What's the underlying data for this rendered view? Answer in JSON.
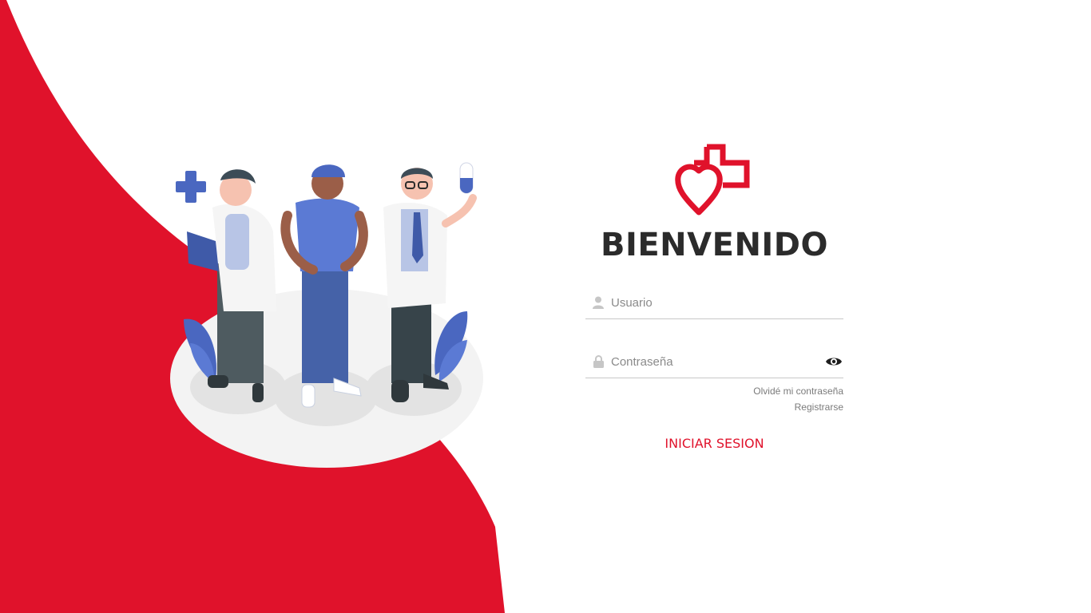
{
  "brand": {
    "accent_color": "#e0122b",
    "logo_icon": "heart-cross-logo-icon"
  },
  "login": {
    "title": "BIENVENIDO",
    "username": {
      "placeholder": "Usuario",
      "value": "",
      "icon": "user-icon"
    },
    "password": {
      "placeholder": "Contraseña",
      "value": "",
      "icon": "lock-icon",
      "toggle_icon": "eye-icon"
    },
    "forgot_password_label": "Olvidé mi contraseña",
    "register_label": "Registrarse",
    "submit_label": "INICIAR SESION"
  },
  "illustration": {
    "subject": "three medical staff figures"
  }
}
